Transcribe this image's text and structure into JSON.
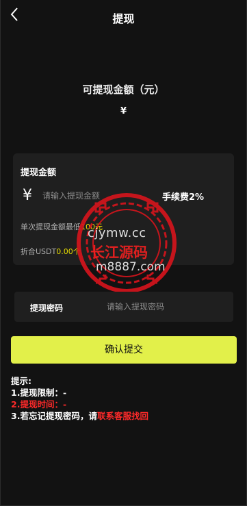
{
  "nav": {
    "title": "提现"
  },
  "balance": {
    "label": "可提现金额（元）",
    "amount": "¥"
  },
  "form": {
    "section_title": "提现金额",
    "currency_symbol": "¥",
    "amount_placeholder": "请输入提现金额",
    "fee_text": "手续费2%",
    "min_prefix": "单次提现金额最低",
    "min_value": "100元",
    "usdt_prefix": "折合USDT",
    "usdt_value": "0.00个"
  },
  "password": {
    "label": "提现密码",
    "placeholder": "请输入提现密码"
  },
  "submit": {
    "label": "确认提交"
  },
  "tips": {
    "heading": "提示:",
    "line1": "1.提现限制：-",
    "line2": "2.提现时间：-",
    "line3_prefix": "3.若忘记提现密码，请",
    "line3_link": "联系客服找回"
  },
  "watermark": {
    "line1": "cjymw.cc",
    "line2": "长江源码",
    "line3": "m8887.com"
  },
  "colors": {
    "background": "#121212",
    "card": "#1f1f1f",
    "accent": "#e2f04a",
    "highlight": "#e8dd00",
    "warning": "#ff2a2a"
  },
  "icons": {
    "back": "chevron-left-icon",
    "currency": "yen-icon",
    "watermark_seal": "seal-ring-icon"
  }
}
